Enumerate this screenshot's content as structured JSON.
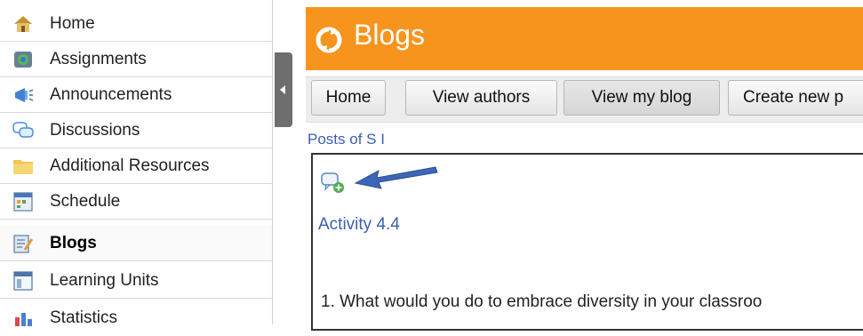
{
  "sidebar": {
    "items": [
      {
        "label": "Home",
        "icon": "home-icon"
      },
      {
        "label": "Assignments",
        "icon": "assignments-icon"
      },
      {
        "label": "Announcements",
        "icon": "announcements-icon"
      },
      {
        "label": "Discussions",
        "icon": "discussions-icon"
      },
      {
        "label": "Additional Resources",
        "icon": "folder-icon"
      },
      {
        "label": "Schedule",
        "icon": "schedule-icon"
      },
      {
        "label": "Blogs",
        "icon": "blogs-icon"
      },
      {
        "label": "Learning Units",
        "icon": "learning-units-icon"
      },
      {
        "label": "Statistics",
        "icon": "statistics-icon"
      }
    ]
  },
  "header": {
    "title": "Blogs",
    "color": "#f7941d"
  },
  "toolbar": {
    "home_label": "Home",
    "view_authors_label": "View authors",
    "view_my_blog_label": "View my blog",
    "create_new_label": "Create new p"
  },
  "main": {
    "posts_of": "Posts of S I",
    "post_title": "Activity 4.4",
    "post_text": "1. What would you do to embrace diversity in your classroo"
  },
  "colors": {
    "accent": "#f7941d",
    "link": "#3b5fb0",
    "annotation_arrow": "#3d66b8"
  }
}
